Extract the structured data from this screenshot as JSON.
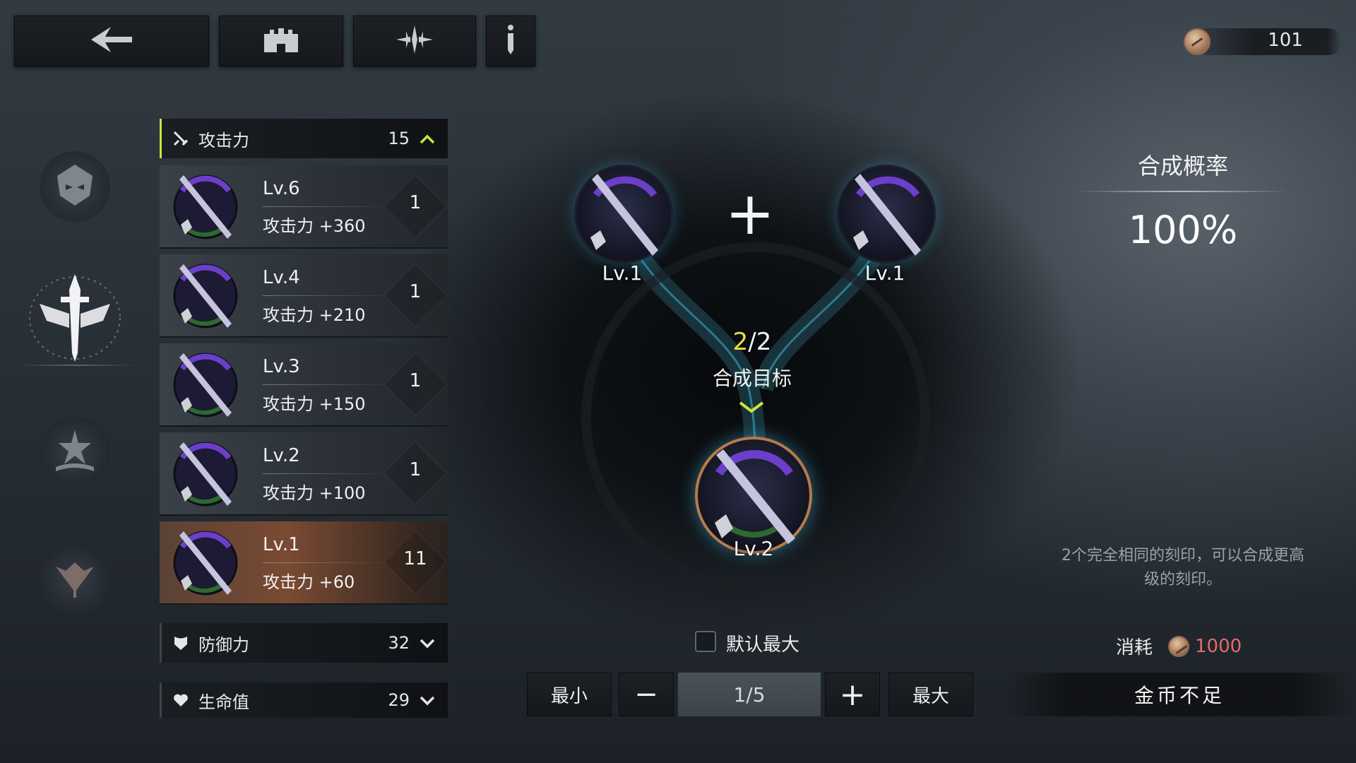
{
  "top": {
    "currency_value": "101"
  },
  "categories": [
    {
      "label": "攻击力",
      "count": "15",
      "expanded": true
    },
    {
      "label": "防御力",
      "count": "32",
      "expanded": false
    },
    {
      "label": "生命值",
      "count": "29",
      "expanded": false
    }
  ],
  "items": [
    {
      "level": "Lv.6",
      "stat": "攻击力 +360",
      "qty": "1"
    },
    {
      "level": "Lv.4",
      "stat": "攻击力 +210",
      "qty": "1"
    },
    {
      "level": "Lv.3",
      "stat": "攻击力 +150",
      "qty": "1"
    },
    {
      "level": "Lv.2",
      "stat": "攻击力 +100",
      "qty": "1"
    },
    {
      "level": "Lv.1",
      "stat": "攻击力 +60",
      "qty": "11"
    }
  ],
  "compose": {
    "left_level": "Lv.1",
    "right_level": "Lv.1",
    "plus": "+",
    "progress_current": "2",
    "progress_total": "/2",
    "target_label": "合成目标",
    "target_level": "Lv.2"
  },
  "panel": {
    "rate_title": "合成概率",
    "rate_value": "100%",
    "description": "2个完全相同的刻印，可以合成更高级的刻印。",
    "cost_label": "消耗",
    "cost_value": "1000",
    "action_label": "金币不足"
  },
  "controls": {
    "default_max_label": "默认最大",
    "min_label": "最小",
    "minus": "−",
    "quantity": "1/5",
    "plus": "+",
    "max_label": "最大"
  },
  "colors": {
    "accent_green": "#c9e63a",
    "progress_yellow": "#e8e040",
    "cost_red": "#e46a6a",
    "selected_item": "#7a4a32"
  }
}
